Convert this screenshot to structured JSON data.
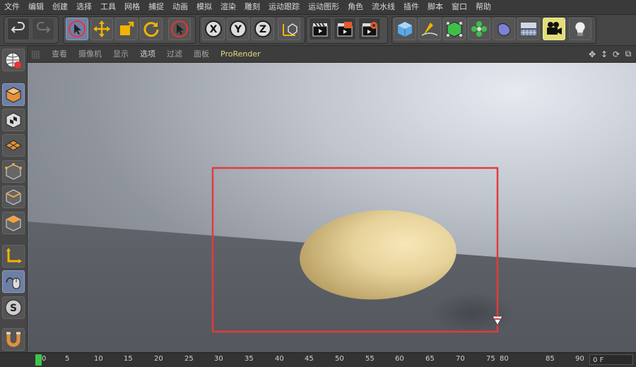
{
  "menu": [
    "文件",
    "编辑",
    "创建",
    "选择",
    "工具",
    "网格",
    "捕捉",
    "动画",
    "模拟",
    "渲染",
    "雕刻",
    "运动跟踪",
    "运动图形",
    "角色",
    "流水线",
    "插件",
    "脚本",
    "窗口",
    "帮助"
  ],
  "toolbar": {
    "axis_x": "X",
    "axis_y": "Y",
    "axis_z": "Z"
  },
  "viewport_menu": [
    "查看",
    "摄像机",
    "显示",
    "选项",
    "过滤",
    "面板",
    "ProRender"
  ],
  "viewport_menu_active": "ProRender",
  "timeline": {
    "ticks": [
      "0",
      "5",
      "10",
      "15",
      "20",
      "25",
      "30",
      "35",
      "40",
      "45",
      "50",
      "55",
      "60",
      "65",
      "70",
      "75",
      "80",
      "85",
      "90"
    ],
    "frame": "0 F"
  },
  "colors": {
    "accent": "#e3dd7a",
    "selection_rect": "#e33b3b",
    "egg": "#e6d29a",
    "playhead": "#3ec34a"
  }
}
